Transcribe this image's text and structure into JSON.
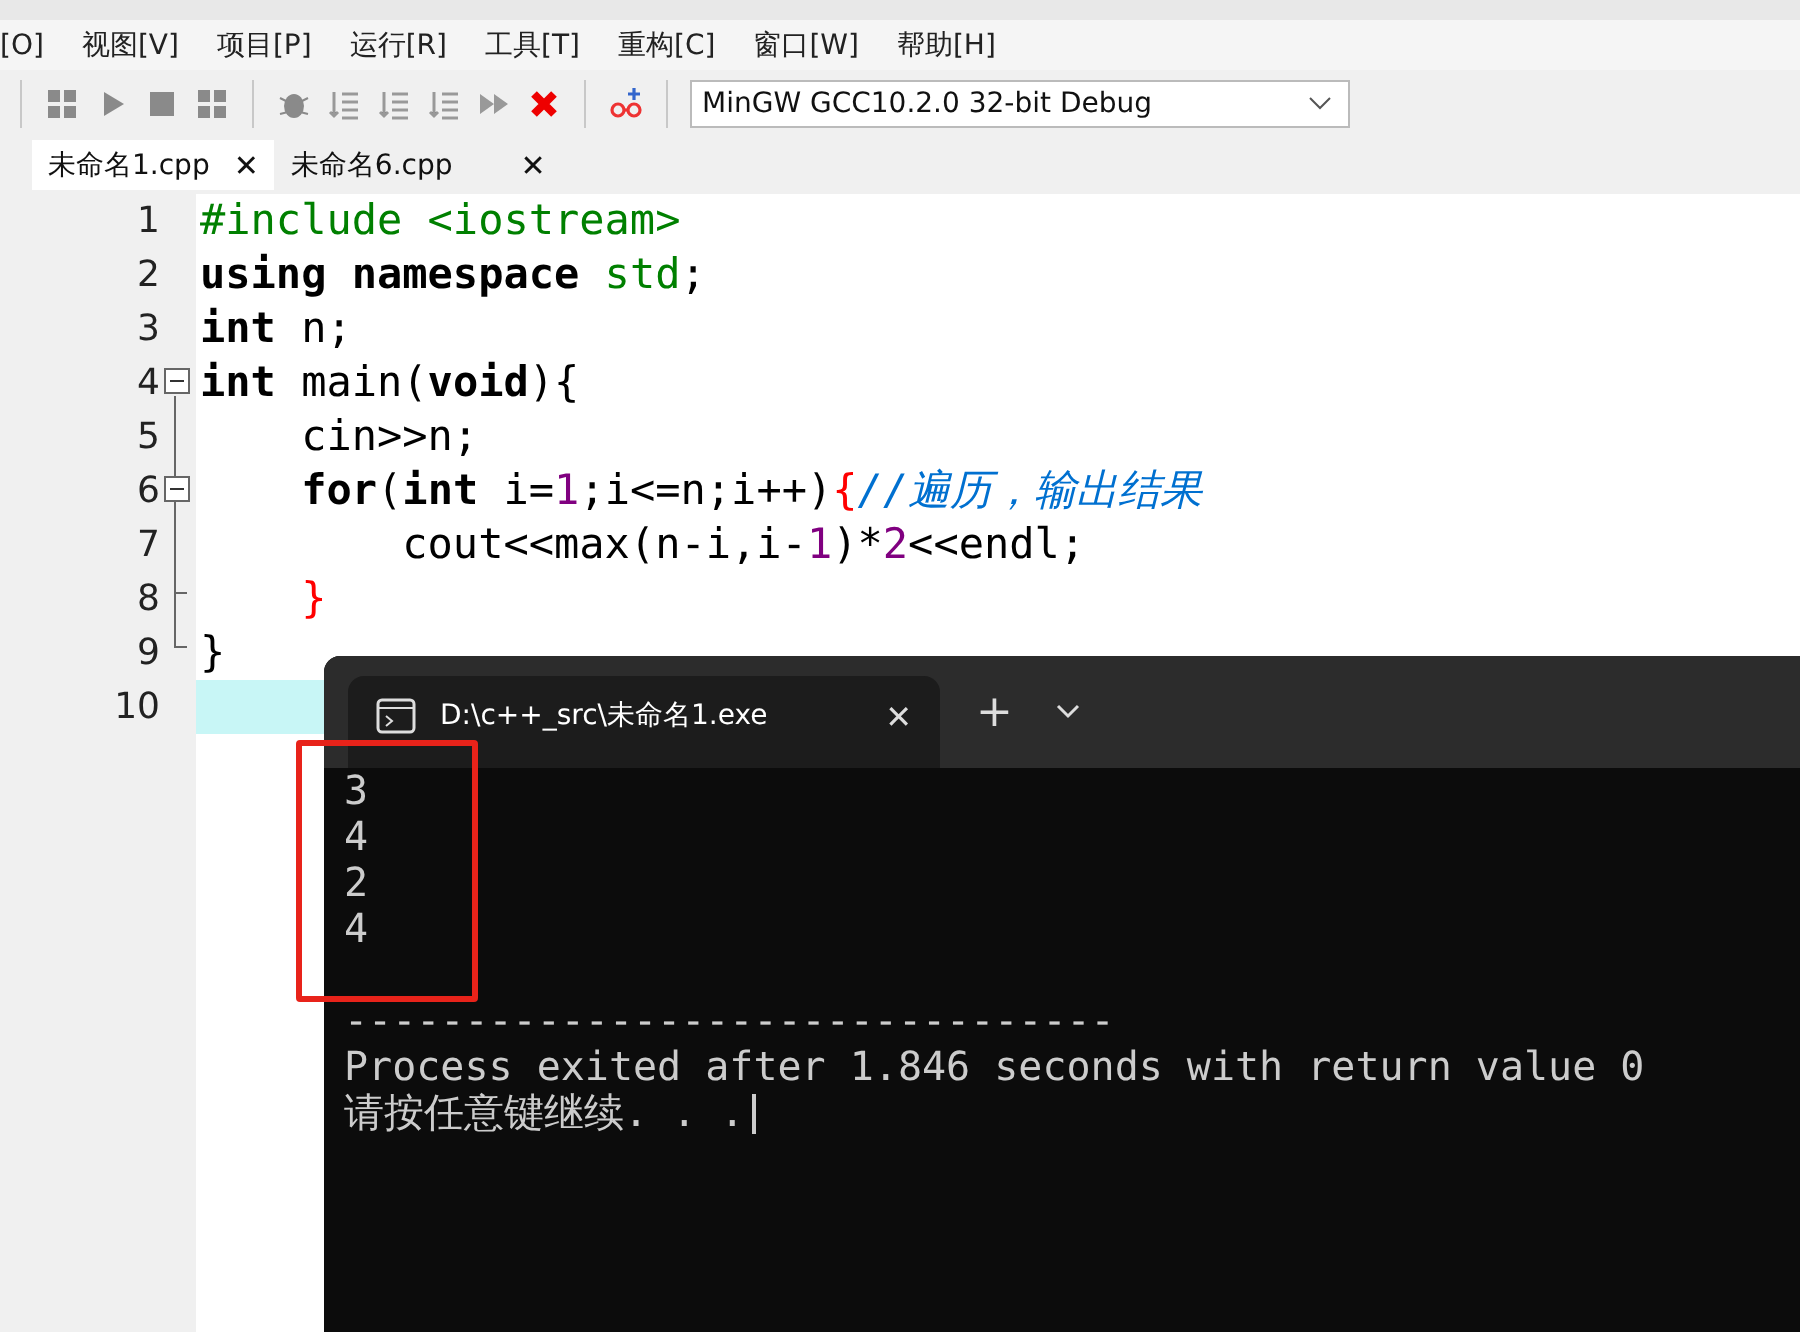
{
  "menu": [
    "[O]",
    "视图[V]",
    "项目[P]",
    "运行[R]",
    "工具[T]",
    "重构[C]",
    "窗口[W]",
    "帮助[H]"
  ],
  "toolbar": {
    "compiler": "MinGW GCC10.2.0 32-bit Debug"
  },
  "tabs": [
    {
      "label": "未命名1.cpp",
      "close": "✕",
      "selected": true
    },
    {
      "label": "未命名6.cpp",
      "close": "✕",
      "selected": false
    }
  ],
  "editor": {
    "lines": [
      {
        "number": "1",
        "current": false,
        "tokens": [
          {
            "text": "#include <iostream>",
            "kind": "pre"
          }
        ]
      },
      {
        "number": "2",
        "current": false,
        "tokens": [
          {
            "text": "using namespace ",
            "kind": "kw"
          },
          {
            "text": "std",
            "kind": "pre"
          },
          {
            "text": ";",
            "kind": "plain"
          }
        ]
      },
      {
        "number": "3",
        "current": false,
        "tokens": [
          {
            "text": "int",
            "kind": "kw"
          },
          {
            "text": " n;",
            "kind": "plain"
          }
        ]
      },
      {
        "number": "4",
        "fold_toggle": {
          "expanded": true
        },
        "current": false,
        "tokens": [
          {
            "text": "int",
            "kind": "kw"
          },
          {
            "text": " main(",
            "kind": "plain"
          },
          {
            "text": "void",
            "kind": "kw"
          },
          {
            "text": "){",
            "kind": "plain"
          }
        ]
      },
      {
        "number": "5",
        "current": false,
        "tokens": [
          {
            "text": "    cin>>n;",
            "kind": "plain"
          }
        ]
      },
      {
        "number": "6",
        "fold_toggle": {
          "expanded": true
        },
        "current": false,
        "tokens": [
          {
            "text": "    for",
            "kind": "kw"
          },
          {
            "text": "(",
            "kind": "plain"
          },
          {
            "text": "int",
            "kind": "kw"
          },
          {
            "text": " i=",
            "kind": "plain"
          },
          {
            "text": "1",
            "kind": "num"
          },
          {
            "text": ";i<=n;i++)",
            "kind": "plain"
          },
          {
            "text": "{",
            "kind": "brace"
          },
          {
            "text": "//遍历，输出结果",
            "kind": "comment"
          }
        ]
      },
      {
        "number": "7",
        "current": false,
        "tokens": [
          {
            "text": "        cout<<max(n-i,i-",
            "kind": "plain"
          },
          {
            "text": "1",
            "kind": "num"
          },
          {
            "text": ")*",
            "kind": "plain"
          },
          {
            "text": "2",
            "kind": "num"
          },
          {
            "text": "<<endl;",
            "kind": "plain"
          }
        ]
      },
      {
        "number": "8",
        "current": false,
        "tokens": [
          {
            "text": "    }",
            "kind": "brace"
          }
        ]
      },
      {
        "number": "9",
        "current": false,
        "tokens": [
          {
            "text": "}",
            "kind": "plain"
          }
        ]
      },
      {
        "number": "10",
        "current": true
      }
    ]
  },
  "terminal": {
    "tab_title": "D:\\c++_src\\未命名1.exe",
    "close": "✕",
    "new_tab": "+",
    "output": {
      "highlighted": true,
      "lines": [
        "3",
        "4",
        "2",
        "4"
      ]
    },
    "separator": "--------------------------------",
    "status": "Process exited after 1.846 seconds with return value 0",
    "prompt": "请按任意键继续. . ."
  }
}
